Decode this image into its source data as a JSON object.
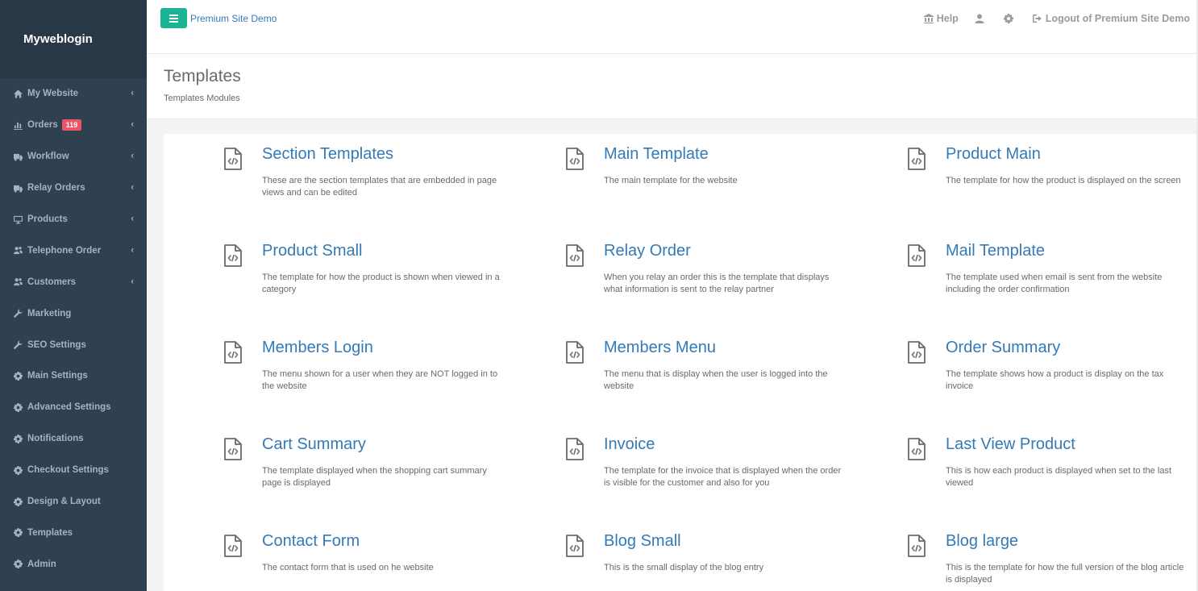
{
  "brand": "Myweblogin",
  "sidebar": {
    "items": [
      {
        "label": "My Website",
        "icon": "home-icon",
        "chevron": true
      },
      {
        "label": "Orders",
        "icon": "bar-chart-icon",
        "chevron": true,
        "badge": "119"
      },
      {
        "label": "Workflow",
        "icon": "truck-icon",
        "chevron": true
      },
      {
        "label": "Relay Orders",
        "icon": "truck-icon",
        "chevron": true
      },
      {
        "label": "Products",
        "icon": "monitor-icon",
        "chevron": true
      },
      {
        "label": "Telephone Order",
        "icon": "users-icon",
        "chevron": true
      },
      {
        "label": "Customers",
        "icon": "users-icon",
        "chevron": true
      },
      {
        "label": "Marketing",
        "icon": "wrench-icon",
        "chevron": false
      },
      {
        "label": "SEO Settings",
        "icon": "wrench-icon",
        "chevron": false
      },
      {
        "label": "Main Settings",
        "icon": "gear-icon",
        "chevron": false
      },
      {
        "label": "Advanced Settings",
        "icon": "gear-icon",
        "chevron": false
      },
      {
        "label": "Notifications",
        "icon": "gear-icon",
        "chevron": false
      },
      {
        "label": "Checkout Settings",
        "icon": "gear-icon",
        "chevron": false
      },
      {
        "label": "Design & Layout",
        "icon": "gear-icon",
        "chevron": false
      },
      {
        "label": "Templates",
        "icon": "gear-icon",
        "chevron": false
      },
      {
        "label": "Admin",
        "icon": "gear-icon",
        "chevron": false
      }
    ]
  },
  "topbar": {
    "site_name": "Premium Site Demo",
    "help": "Help",
    "logout": "Logout of Premium Site Demo",
    "accent": "#1ab394"
  },
  "page": {
    "title": "Templates",
    "subtitle": "Templates Modules"
  },
  "templates": [
    {
      "title": "Section Templates",
      "desc": "These are the section templates that are embedded in page views and can be edited"
    },
    {
      "title": "Main Template",
      "desc": "The main template for the website"
    },
    {
      "title": "Product Main",
      "desc": "The template for how the product is displayed on the screen"
    },
    {
      "title": "Product Small",
      "desc": "The template for how the product is shown when viewed in a category"
    },
    {
      "title": "Relay Order",
      "desc": "When you relay an order this is the template that displays what information is sent to the relay partner"
    },
    {
      "title": "Mail Template",
      "desc": "The template used when email is sent from the website including the order confirmation"
    },
    {
      "title": "Members Login",
      "desc": "The menu shown for a user when they are NOT logged in to the website"
    },
    {
      "title": "Members Menu",
      "desc": "The menu that is display when the user is logged into the website"
    },
    {
      "title": "Order Summary",
      "desc": "The template shows how a product is display on the tax invoice"
    },
    {
      "title": "Cart Summary",
      "desc": "The template displayed when the shopping cart summary page is displayed"
    },
    {
      "title": "Invoice",
      "desc": "The template for the invoice that is displayed when the order is visible for the customer and also for you"
    },
    {
      "title": "Last View Product",
      "desc": "This is how each product is displayed when set to the last viewed"
    },
    {
      "title": "Contact Form",
      "desc": "The contact form that is used on he website"
    },
    {
      "title": "Blog Small",
      "desc": "This is the small display of the blog entry"
    },
    {
      "title": "Blog large",
      "desc": "This is the template for how the full version of the blog article is displayed"
    }
  ]
}
